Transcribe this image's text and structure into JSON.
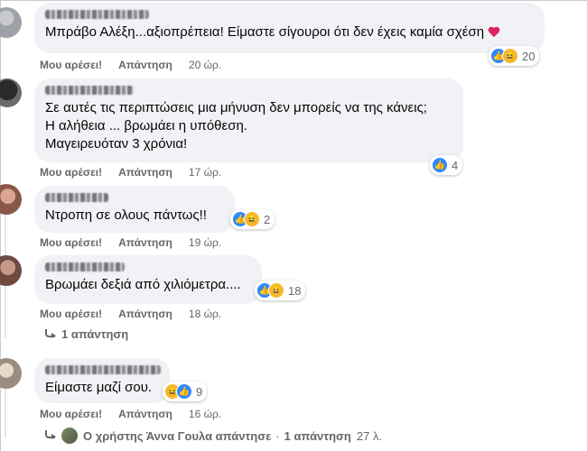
{
  "comments": [
    {
      "text": [
        "Μπράβο Αλέξη...αξιοπρέπεια! Είμαστε σίγουροι ότι δεν έχεις καμία σχέση"
      ],
      "reaction_count": "20",
      "like_label": "Μου αρέσει!",
      "reply_label": "Απάντηση",
      "time": "20 ώρ."
    },
    {
      "text": [
        "Σε αυτές τις περιπτώσεις μια μήνυση δεν μπορείς να της κάνεις;",
        "Η αλήθεια ... βρωμάει η υπόθεση.",
        "Μαγειρευόταν 3 χρόνια!"
      ],
      "reaction_count": "4",
      "like_label": "Μου αρέσει!",
      "reply_label": "Απάντηση",
      "time": "17 ώρ."
    },
    {
      "text": [
        "Ντροπη σε ολους πάντως!!"
      ],
      "reaction_count": "2",
      "like_label": "Μου αρέσει!",
      "reply_label": "Απάντηση",
      "time": "19 ώρ."
    },
    {
      "text": [
        "Βρωμάει δεξιά από χιλιόμετρα...."
      ],
      "reaction_count": "18",
      "like_label": "Μου αρέσει!",
      "reply_label": "Απάντηση",
      "time": "18 ώρ.",
      "replies_link": "1 απάντηση"
    },
    {
      "text": [
        "Είμαστε μαζί σου."
      ],
      "reaction_count": "9",
      "like_label": "Μου αρέσει!",
      "reply_label": "Απάντηση",
      "time": "16 ώρ.",
      "reply_summary": {
        "prefix": "Ο χρήστης Άννα Γουλα απάντησε",
        "separator": "·",
        "count": "1 απάντηση",
        "time": "27 λ."
      }
    }
  ],
  "colors": {
    "bubble": "#f0f2f5",
    "like": "#2d88ff",
    "haha": "#f7b928",
    "heart": "#f33e58",
    "meta": "#65676b"
  }
}
